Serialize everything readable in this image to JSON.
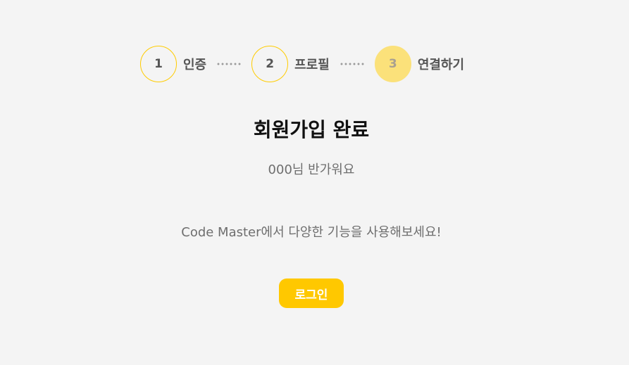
{
  "stepper": {
    "steps": [
      {
        "number": "1",
        "label": "인증",
        "active": false
      },
      {
        "number": "2",
        "label": "프로필",
        "active": false
      },
      {
        "number": "3",
        "label": "연결하기",
        "active": true
      }
    ]
  },
  "main": {
    "title": "회원가입 완료",
    "greeting": "000님 반가워요",
    "message": "Code Master에서 다양한 기능을 사용해보세요!",
    "login_label": "로그인"
  },
  "colors": {
    "accent": "#ffc800",
    "active_step": "#fbe17a",
    "step_border": "#ffcc00",
    "background": "#f4f4f4"
  }
}
